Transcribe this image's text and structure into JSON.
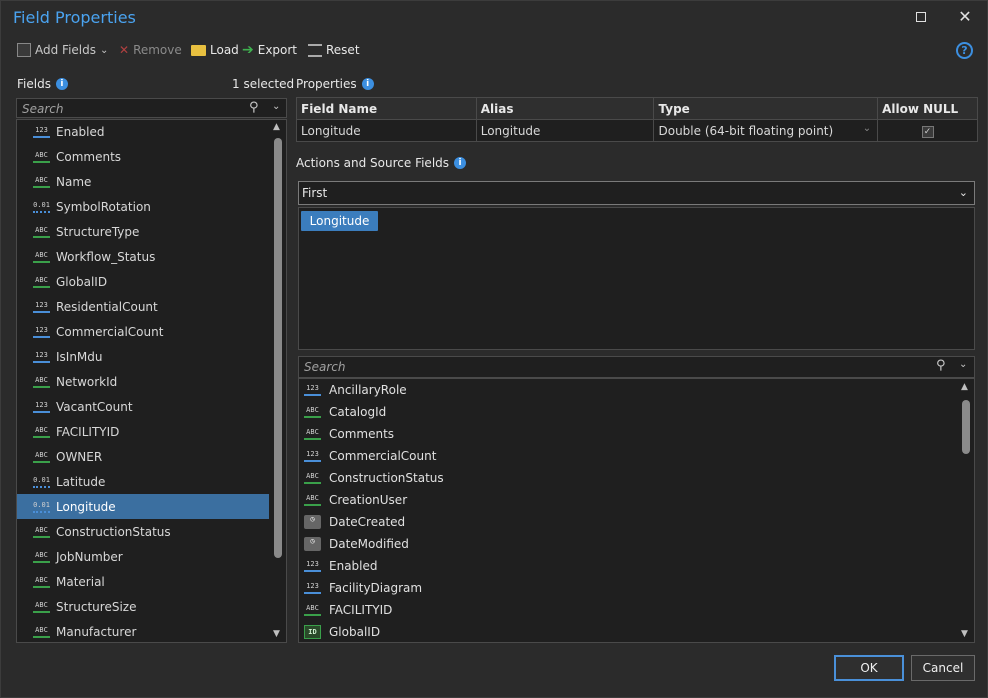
{
  "window": {
    "title": "Field Properties"
  },
  "toolbar": {
    "add_fields": "Add Fields",
    "remove": "Remove",
    "load": "Load",
    "export": "Export",
    "reset": "Reset",
    "help": "?"
  },
  "fields": {
    "label": "Fields",
    "selected_count": "1 selected",
    "search_placeholder": "Search",
    "items": [
      {
        "name": "Enabled",
        "type": "123"
      },
      {
        "name": "Comments",
        "type": "ABC"
      },
      {
        "name": "Name",
        "type": "ABC"
      },
      {
        "name": "SymbolRotation",
        "type": "0.01"
      },
      {
        "name": "StructureType",
        "type": "ABC"
      },
      {
        "name": "Workflow_Status",
        "type": "ABC"
      },
      {
        "name": "GlobalID",
        "type": "ABC"
      },
      {
        "name": "ResidentialCount",
        "type": "123"
      },
      {
        "name": "CommercialCount",
        "type": "123"
      },
      {
        "name": "IsInMdu",
        "type": "123"
      },
      {
        "name": "NetworkId",
        "type": "ABC"
      },
      {
        "name": "VacantCount",
        "type": "123"
      },
      {
        "name": "FACILITYID",
        "type": "ABC"
      },
      {
        "name": "OWNER",
        "type": "ABC"
      },
      {
        "name": "Latitude",
        "type": "0.01"
      },
      {
        "name": "Longitude",
        "type": "0.01"
      },
      {
        "name": "ConstructionStatus",
        "type": "ABC"
      },
      {
        "name": "JobNumber",
        "type": "ABC"
      },
      {
        "name": "Material",
        "type": "ABC"
      },
      {
        "name": "StructureSize",
        "type": "ABC"
      },
      {
        "name": "Manufacturer",
        "type": "ABC"
      }
    ]
  },
  "properties": {
    "label": "Properties",
    "headers": [
      "Field Name",
      "Alias",
      "Type",
      "Allow NULL"
    ],
    "row": {
      "field_name": "Longitude",
      "alias": "Longitude",
      "type": "Double (64-bit floating point)",
      "allow_null": true
    }
  },
  "actions": {
    "label": "Actions and Source Fields",
    "action_value": "First",
    "source_tag": "Longitude",
    "search_placeholder": "Search",
    "source_items": [
      {
        "name": "AncillaryRole",
        "type": "123"
      },
      {
        "name": "CatalogId",
        "type": "ABC"
      },
      {
        "name": "Comments",
        "type": "ABC"
      },
      {
        "name": "CommercialCount",
        "type": "123"
      },
      {
        "name": "ConstructionStatus",
        "type": "ABC"
      },
      {
        "name": "CreationUser",
        "type": "ABC"
      },
      {
        "name": "DateCreated",
        "type": "date"
      },
      {
        "name": "DateModified",
        "type": "date"
      },
      {
        "name": "Enabled",
        "type": "123"
      },
      {
        "name": "FacilityDiagram",
        "type": "123"
      },
      {
        "name": "FACILITYID",
        "type": "ABC"
      },
      {
        "name": "GlobalID",
        "type": "ID"
      }
    ]
  },
  "footer": {
    "ok": "OK",
    "cancel": "Cancel"
  },
  "colors": {
    "accent": "#4aa3f0",
    "selection": "#3b6fa0",
    "tag": "#3b7dbd"
  }
}
